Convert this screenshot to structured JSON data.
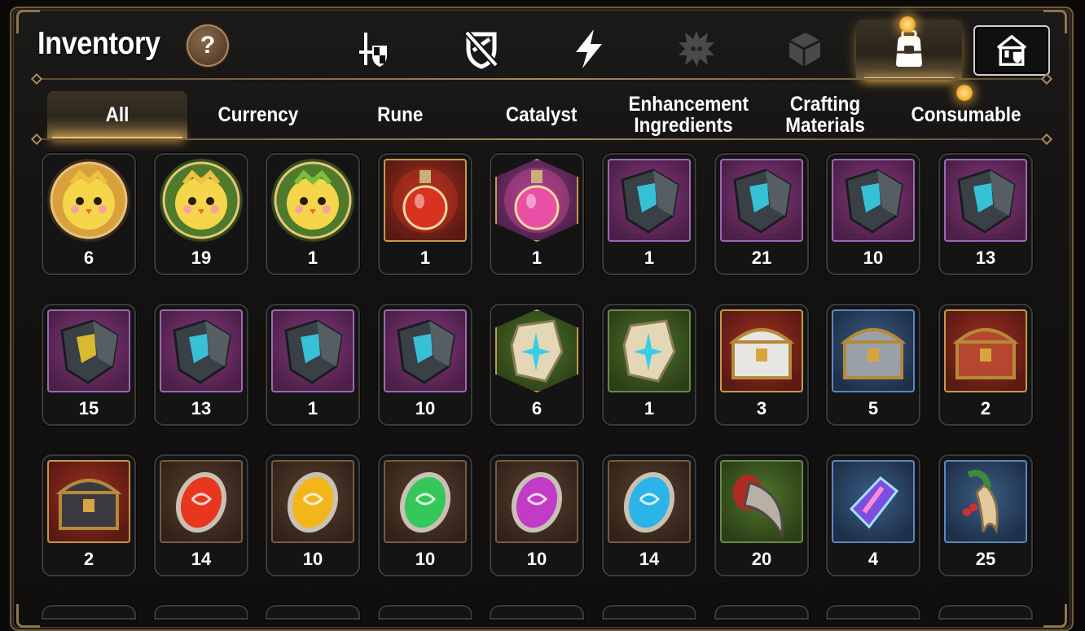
{
  "header": {
    "title": "Inventory",
    "help_label": "?"
  },
  "category_tabs": [
    {
      "icon": "sword-shield-icon",
      "active": false
    },
    {
      "icon": "broken-shield-icon",
      "active": false
    },
    {
      "icon": "lightning-icon",
      "active": false
    },
    {
      "icon": "spiky-creature-icon",
      "active": false
    },
    {
      "icon": "cube-box-icon",
      "active": false
    },
    {
      "icon": "bag-icon",
      "active": true,
      "notification": true
    },
    {
      "icon": "home-shop-icon",
      "active": false
    }
  ],
  "sub_tabs": [
    {
      "label": "All",
      "active": true
    },
    {
      "label": "Currency",
      "active": false
    },
    {
      "label": "Rune",
      "active": false
    },
    {
      "label": "Catalyst",
      "active": false
    },
    {
      "label": "Enhancement Ingredients",
      "active": false
    },
    {
      "label": "Crafting Materials",
      "active": false
    },
    {
      "label": "Consumable",
      "active": false,
      "notification": true
    }
  ],
  "colors": {
    "accent_gold": "#f4c774",
    "frame_brown": "#8d7550",
    "text": "#ffffff",
    "notification_glow": "#f6b73c"
  },
  "items": [
    {
      "icon": "yellow-chick-gold-token-icon",
      "count": "6"
    },
    {
      "icon": "yellow-chick-green-token-icon",
      "count": "19"
    },
    {
      "icon": "yellow-chick-laurel-token-icon",
      "count": "1"
    },
    {
      "icon": "red-potion-icon",
      "count": "1"
    },
    {
      "icon": "pink-potion-icon",
      "count": "1"
    },
    {
      "icon": "ring-rune-stone-icon",
      "count": "1"
    },
    {
      "icon": "hammer-rune-stone-icon",
      "count": "21"
    },
    {
      "icon": "boot-rune-stone-icon",
      "count": "10"
    },
    {
      "icon": "armor-rune-stone-icon",
      "count": "13"
    },
    {
      "icon": "exclaim-rune-stone-icon",
      "count": "15"
    },
    {
      "icon": "sword-rune-stone-icon",
      "count": "13"
    },
    {
      "icon": "necklace-rune-stone-icon",
      "count": "1"
    },
    {
      "icon": "helmet-rune-stone-icon",
      "count": "10"
    },
    {
      "icon": "star-tablet-icon",
      "count": "6"
    },
    {
      "icon": "sword-tablet-icon",
      "count": "1"
    },
    {
      "icon": "white-gold-chest-icon",
      "count": "3"
    },
    {
      "icon": "silver-chest-icon",
      "count": "5"
    },
    {
      "icon": "holiday-chest-icon",
      "count": "2"
    },
    {
      "icon": "dark-gold-chest-icon",
      "count": "2"
    },
    {
      "icon": "red-gem-icon",
      "count": "14"
    },
    {
      "icon": "yellow-gem-icon",
      "count": "10"
    },
    {
      "icon": "green-gem-icon",
      "count": "10"
    },
    {
      "icon": "purple-gem-icon",
      "count": "10"
    },
    {
      "icon": "blue-gem-icon",
      "count": "14"
    },
    {
      "icon": "claw-icon",
      "count": "20"
    },
    {
      "icon": "crystal-icon",
      "count": "4"
    },
    {
      "icon": "ginseng-root-icon",
      "count": "25"
    }
  ]
}
